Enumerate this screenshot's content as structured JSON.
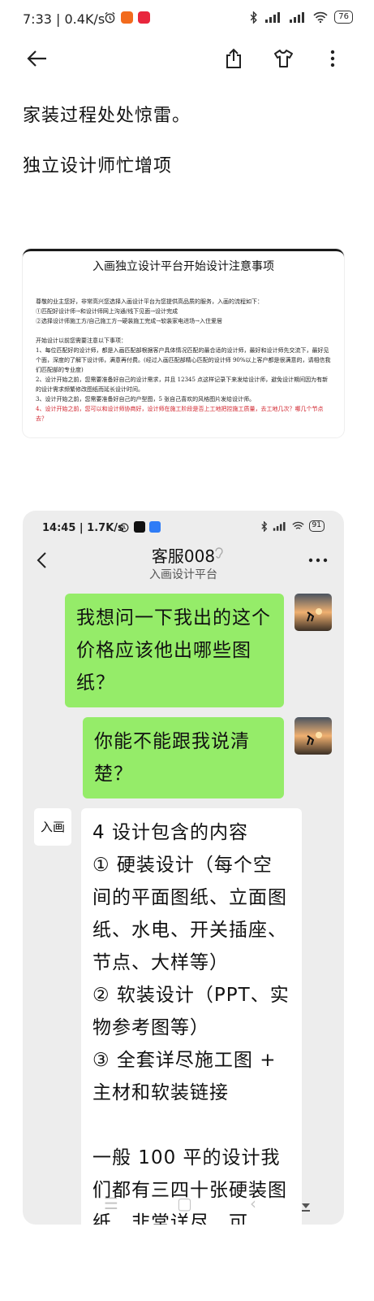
{
  "status_bar": {
    "time": "7:33 | 0.4K/s",
    "battery": "76"
  },
  "post": {
    "line1": "家装过程处处惊雷。",
    "line2": "独立设计师忙增项"
  },
  "document": {
    "title": "入画独立设计平台开始设计注意事项",
    "intro": "尊敬的业主您好，非常高兴您选择入画设计平台为您提供高品质的服务，入画的流程如下：",
    "flow1": "①匹配好设计师→和设计师网上沟通/线下见面→设计完成",
    "flow2": "②选择设计师施工方/自己施工方→硬装施工完成→软装家电进场→入住爱居",
    "notes_heading": "开始设计以前您需要注意以下事项：",
    "note1": "1、每位匹配好的设计师，都是入画匹配部根据客户具体情况匹配的最合适的设计师，最好和设计师先交流下，最好见个面，深度的了解下设计师，满意再付费。(经过入画匹配部精心匹配的设计师 90%以上客户都是很满意的，请相信我们匹配部的专业度)",
    "note2": "2、设计开始之前，您需要准备好自己的设计需求，并且 12345 点这样记录下来发给设计师，避免设计期间因为有新的设计需求频繁修改图纸而延长设计时间。",
    "note3": "3、设计开始之前，您需要准备好自己的户型图，5 张自己喜欢的风格图片发给设计师。",
    "note4": "4、设计开始之前，您可以和设计师协商好，设计师在施工阶段是否上工地把控施工质量，去工地几次？哪几个节点去？"
  },
  "chat": {
    "status_time": "14:45 | 1.7K/s",
    "battery": "91",
    "contact_name": "客服008",
    "contact_sub": "入画设计平台",
    "logo_text": "入画",
    "messages": [
      {
        "side": "right",
        "text": "我想问一下我出的这个价格应该他出哪些图纸？"
      },
      {
        "side": "right",
        "text": "你能不能跟我说清楚？"
      },
      {
        "side": "left",
        "text": "4 设计包含的内容\n① 硬装设计（每个空间的平面图纸、立面图纸、水电、开关插座、节点、大样等）\n② 软装设计（PPT、实物参考图等）\n③ 全套详尽施工图 + 主材和软装链接\n\n一般 100 平的设计我们都有三四十张硬装图纸，非常详尽，可"
      }
    ]
  },
  "colors": {
    "green_bubble": "#95ec69",
    "chat_bg": "#ededed",
    "doc_red": "#d0202a"
  }
}
